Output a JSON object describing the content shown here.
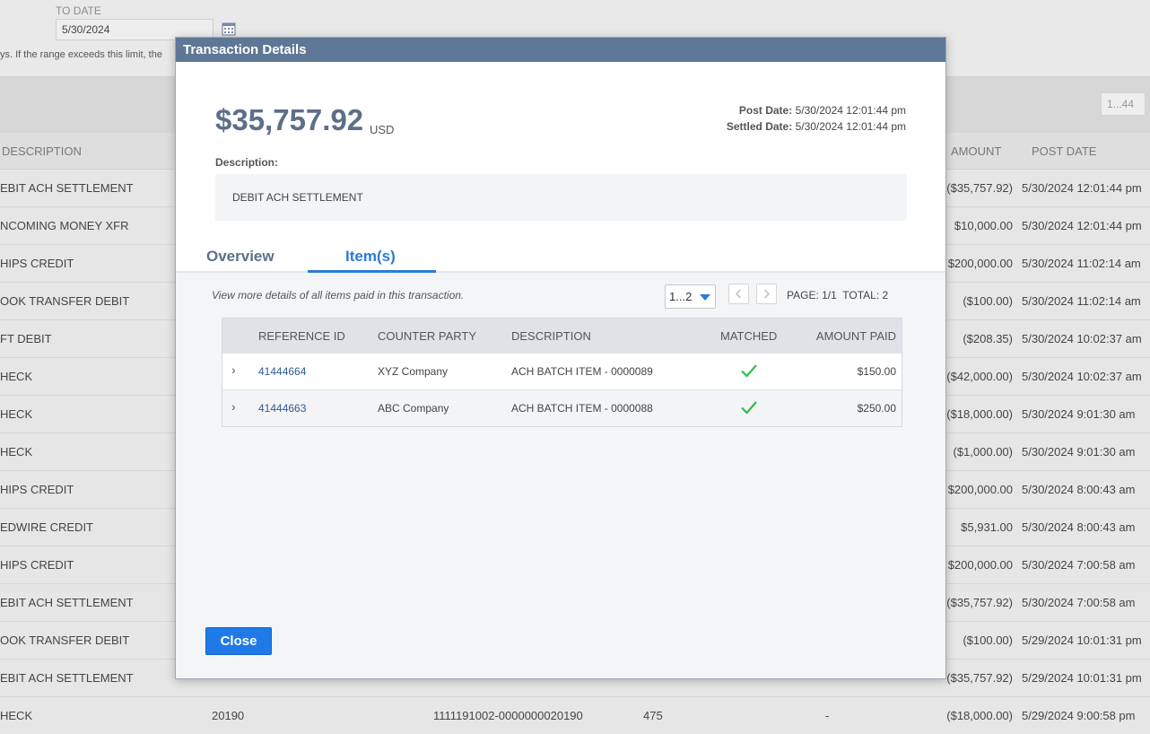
{
  "background": {
    "to_date_label": "TO DATE",
    "to_date_value": "5/30/2024",
    "range_note": "ys. If the range exceeds this limit, the",
    "page_range": "1...44",
    "headers": {
      "description": "DESCRIPTION",
      "amount": "AMOUNT",
      "post_date": "POST DATE"
    },
    "rows": [
      {
        "desc": "EBIT ACH SETTLEMENT",
        "amount": "($35,757.92)",
        "date": "5/30/2024 12:01:44 pm"
      },
      {
        "desc": "NCOMING MONEY XFR",
        "amount": "$10,000.00",
        "date": "5/30/2024 12:01:44 pm"
      },
      {
        "desc": "HIPS CREDIT",
        "amount": "$200,000.00",
        "date": "5/30/2024 11:02:14 am"
      },
      {
        "desc": "OOK TRANSFER DEBIT",
        "amount": "($100.00)",
        "date": "5/30/2024 11:02:14 am"
      },
      {
        "desc": "FT DEBIT",
        "amount": "($208.35)",
        "date": "5/30/2024 10:02:37 am"
      },
      {
        "desc": "HECK",
        "amount": "($42,000.00)",
        "date": "5/30/2024 10:02:37 am"
      },
      {
        "desc": "HECK",
        "amount": "($18,000.00)",
        "date": "5/30/2024 9:01:30 am"
      },
      {
        "desc": "HECK",
        "amount": "($1,000.00)",
        "date": "5/30/2024 9:01:30 am"
      },
      {
        "desc": "HIPS CREDIT",
        "amount": "$200,000.00",
        "date": "5/30/2024 8:00:43 am"
      },
      {
        "desc": "EDWIRE CREDIT",
        "amount": "$5,931.00",
        "date": "5/30/2024 8:00:43 am"
      },
      {
        "desc": "HIPS CREDIT",
        "amount": "$200,000.00",
        "date": "5/30/2024 7:00:58 am"
      },
      {
        "desc": "EBIT ACH SETTLEMENT",
        "amount": "($35,757.92)",
        "date": "5/30/2024 7:00:58 am"
      },
      {
        "desc": "OOK TRANSFER DEBIT",
        "amount": "($100.00)",
        "date": "5/29/2024 10:01:31 pm"
      },
      {
        "desc": "EBIT ACH SETTLEMENT",
        "amount": "($35,757.92)",
        "date": "5/29/2024 10:01:31 pm"
      },
      {
        "desc": "HECK",
        "amount": "($18,000.00)",
        "date": "5/29/2024 9:00:58 pm",
        "ref": "20190",
        "account": "1111191002-0000000020190",
        "num": "475",
        "dash": "-"
      }
    ]
  },
  "modal": {
    "title": "Transaction Details",
    "amount": "$35,757.92",
    "currency": "USD",
    "post_date_label": "Post Date:",
    "post_date_value": "5/30/2024 12:01:44 pm",
    "settled_date_label": "Settled Date:",
    "settled_date_value": "5/30/2024 12:01:44 pm",
    "description_label": "Description:",
    "description_value": "DEBIT ACH SETTLEMENT",
    "tabs": {
      "overview": "Overview",
      "items": "Item(s)"
    },
    "active_tab": "Item(s)",
    "hint": "View more details of all items paid in this transaction.",
    "pager": {
      "select_value": "1...2",
      "page_info": "PAGE: 1/1  TOTAL: 2"
    },
    "table": {
      "headers": {
        "reference_id": "REFERENCE ID",
        "counter_party": "COUNTER PARTY",
        "description": "DESCRIPTION",
        "matched": "MATCHED",
        "amount_paid": "AMOUNT PAID"
      },
      "rows": [
        {
          "reference_id": "41444664",
          "counter_party": "XYZ Company",
          "description": "ACH BATCH ITEM - 0000089",
          "matched": true,
          "amount_paid": "$150.00"
        },
        {
          "reference_id": "41444663",
          "counter_party": "ABC Company",
          "description": "ACH BATCH ITEM - 0000088",
          "matched": true,
          "amount_paid": "$250.00"
        }
      ]
    },
    "close_label": "Close"
  },
  "colors": {
    "title_bar": "#5f7796",
    "accent": "#2b7bd5",
    "check": "#2fbf4a",
    "amount": "#5c6f8a"
  }
}
